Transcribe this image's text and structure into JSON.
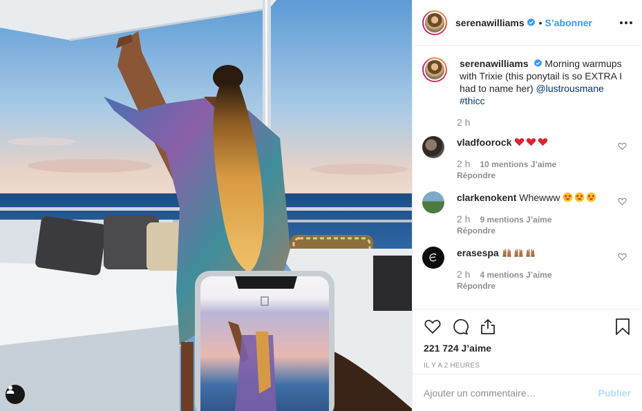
{
  "post_author": {
    "username": "serenawilliams",
    "follow_label": "S’abonner",
    "dot": "•"
  },
  "caption": {
    "username": "serenawilliams",
    "text": "Morning warmups with Trixie (this ponytail is so EXTRA I had to name her)",
    "mention": "@lustrousmane",
    "hashtag": "#thicc",
    "time": "2 h"
  },
  "comments": [
    {
      "username": "vladfoorock",
      "emoji": [
        "red-heart",
        "red-heart",
        "red-heart"
      ],
      "text": "",
      "time": "2 h",
      "likes": "10 mentions J’aime",
      "reply": "Répondre"
    },
    {
      "username": "clarkenokent",
      "emoji": [
        "star-struck",
        "star-struck",
        "star-struck"
      ],
      "text": "Whewww",
      "time": "2 h",
      "likes": "9 mentions J’aime",
      "reply": "Répondre"
    },
    {
      "username": "erasespa",
      "emoji": [
        "raising-hands",
        "raising-hands",
        "raising-hands"
      ],
      "text": "",
      "time": "2 h",
      "likes": "4 mentions J’aime",
      "reply": "Répondre"
    }
  ],
  "stats": {
    "likes": "221 724 J’aime",
    "posted": "IL Y A 2 HEURES"
  },
  "add_comment": {
    "placeholder": "Ajouter un commentaire…",
    "publish_label": "Publier"
  },
  "colors": {
    "accent": "#3897f0",
    "publish_disabled": "#b2dffc",
    "muted": "#8e8e8e",
    "link": "#003569"
  }
}
